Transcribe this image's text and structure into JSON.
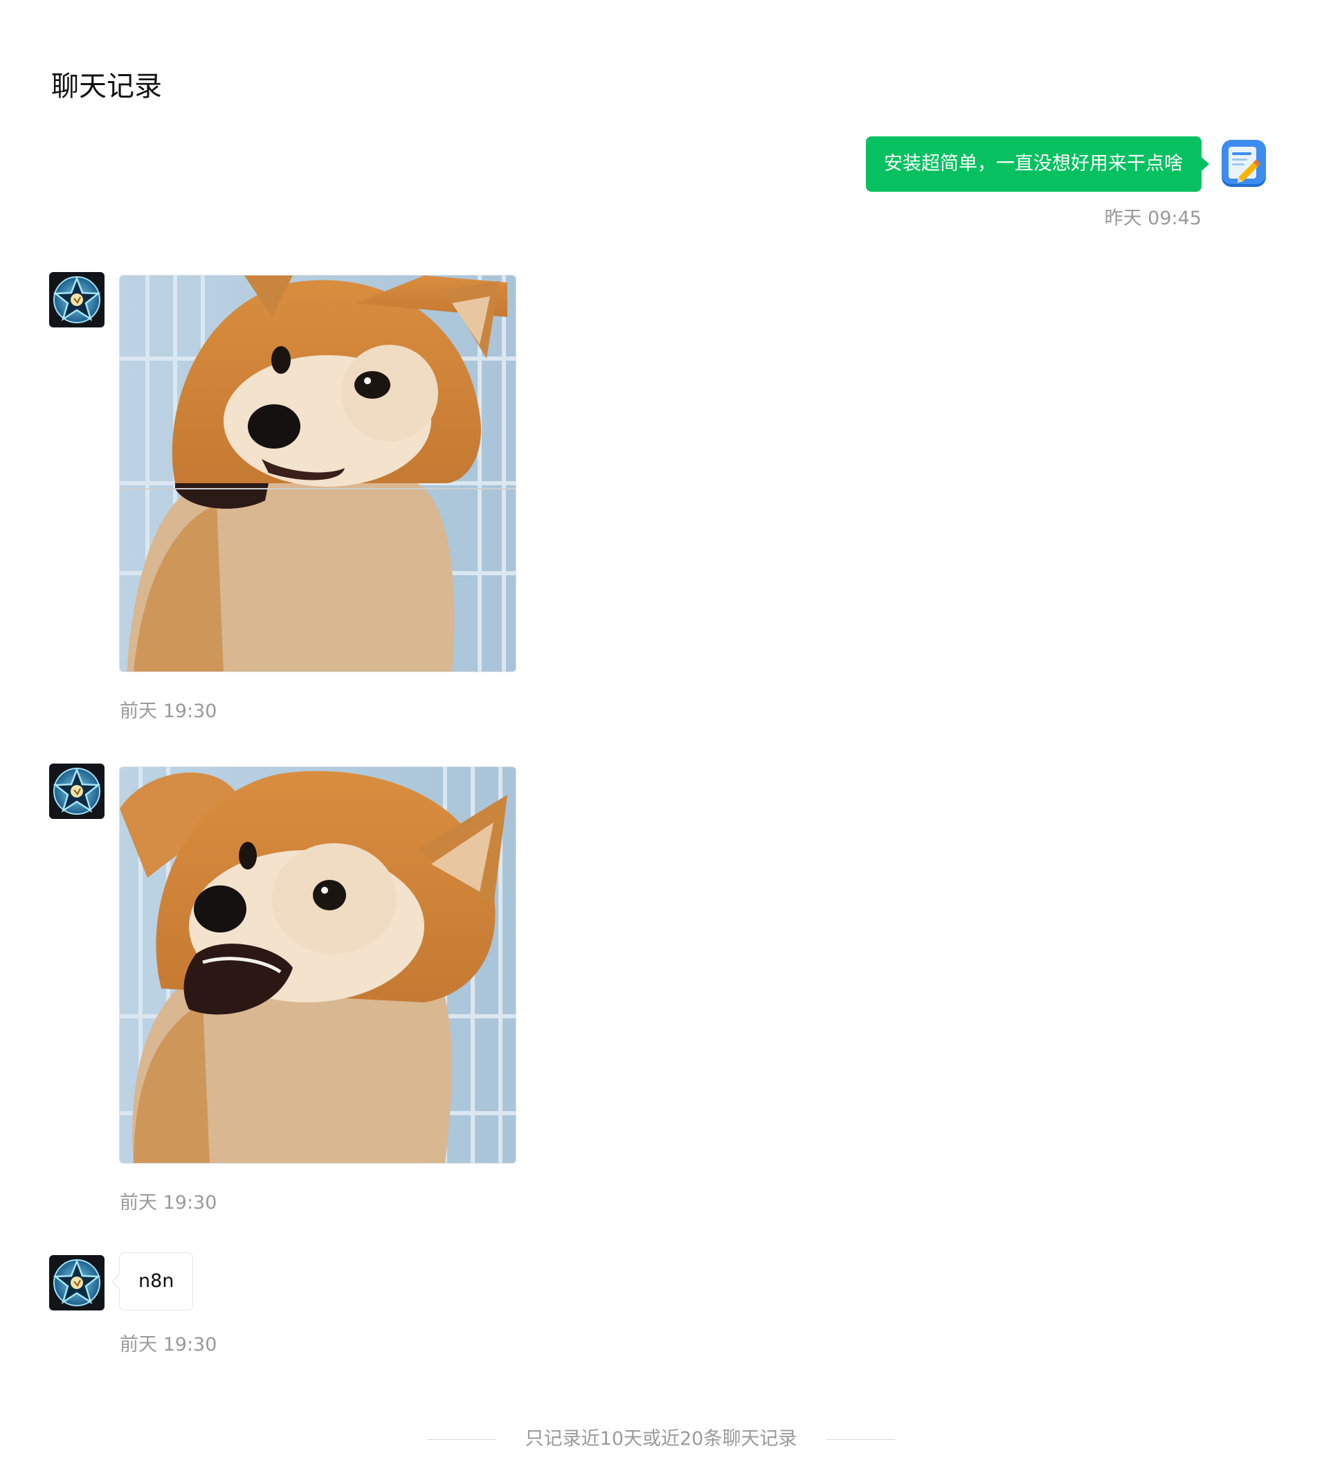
{
  "page_title": "聊天记录",
  "messages": [
    {
      "direction": "out",
      "type": "text",
      "text": "安装超简单，一直没想好用来干点啥",
      "time": "昨天 09:45",
      "avatar_icon": "notepad-pencil-icon"
    },
    {
      "direction": "in",
      "type": "image",
      "image_icon": "shiba-sticker-image",
      "time": "前天 19:30",
      "avatar_icon": "star-emblem-icon"
    },
    {
      "direction": "in",
      "type": "image",
      "image_icon": "shiba-sticker-image",
      "time": "前天 19:30",
      "avatar_icon": "star-emblem-icon"
    },
    {
      "direction": "in",
      "type": "text",
      "text": "n8n",
      "time": "前天 19:30",
      "avatar_icon": "star-emblem-icon"
    }
  ],
  "footer_note": "只记录近10天或近20条聊天记录",
  "colors": {
    "outgoing_bubble": "#07c160",
    "timestamp": "#9a9a9a",
    "background": "#ffffff"
  }
}
